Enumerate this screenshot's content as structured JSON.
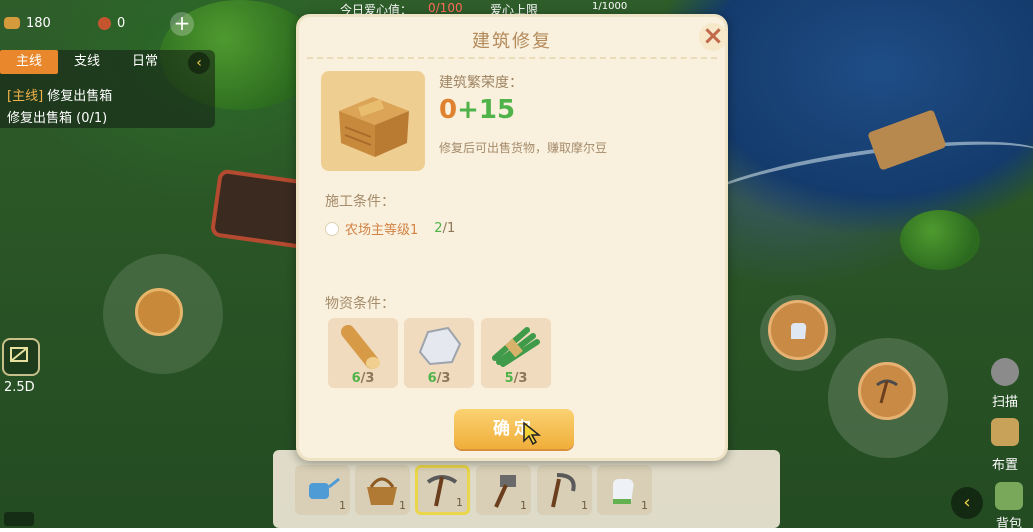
{
  "hud": {
    "wood_count": "180",
    "bean_count": "0",
    "top_status": {
      "love_label": "今日爱心值：",
      "love_value": "0/100",
      "limit_label": "爱心上限",
      "bar_value": "1/1000"
    }
  },
  "quest": {
    "tabs": [
      {
        "label": "主线",
        "active": true
      },
      {
        "label": "支线",
        "active": false
      },
      {
        "label": "日常",
        "active": false
      }
    ],
    "tag": "[主线]",
    "title": "修复出售箱",
    "progress": "修复出售箱 (0/1)"
  },
  "view_mode": "2.5D",
  "side_buttons": {
    "scan": "扫描",
    "layout": "布置",
    "bag": "背包"
  },
  "toolbar": {
    "slots": [
      {
        "icon": "watering-can-icon",
        "count": "1",
        "selected": false
      },
      {
        "icon": "basket-icon",
        "count": "1",
        "selected": false
      },
      {
        "icon": "pickaxe-icon",
        "count": "1",
        "selected": true
      },
      {
        "icon": "hammer-icon",
        "count": "1",
        "selected": false
      },
      {
        "icon": "sickle-icon",
        "count": "1",
        "selected": false
      },
      {
        "icon": "glove-icon",
        "count": "1",
        "selected": false
      }
    ]
  },
  "dialog": {
    "title": "建筑修复",
    "prosperity_label": "建筑繁荣度：",
    "prosperity_base": "0",
    "prosperity_increase": "+15",
    "description": "修复后可出售货物，赚取摩尔豆",
    "construction_label": "施工条件：",
    "condition": {
      "text": "农场主等级1",
      "have": "2",
      "need": "/1"
    },
    "materials_label": "物资条件：",
    "materials": [
      {
        "icon": "wood-log-icon",
        "have": "6",
        "need": "/3"
      },
      {
        "icon": "stone-icon",
        "have": "6",
        "need": "/3"
      },
      {
        "icon": "grass-bundle-icon",
        "have": "5",
        "need": "/3"
      }
    ],
    "confirm_label": "确定"
  },
  "colors": {
    "accent_orange": "#e0812f",
    "success_green": "#4fb34a",
    "dialog_bg": "#f9f0dd"
  }
}
